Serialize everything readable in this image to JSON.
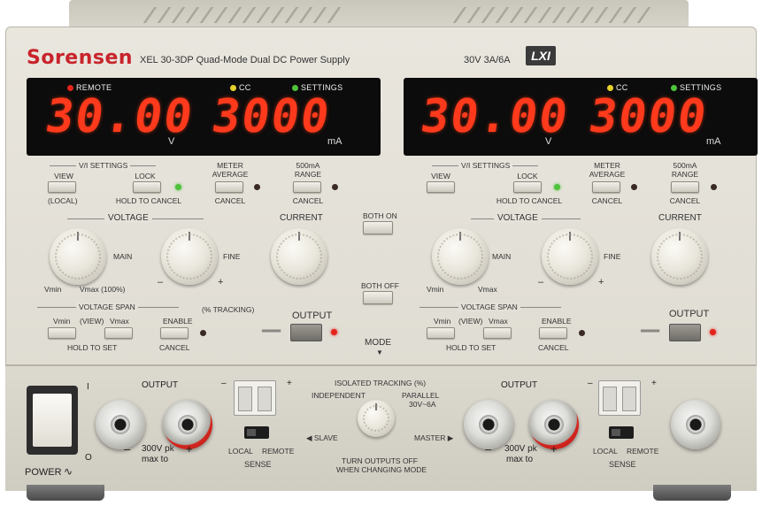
{
  "header": {
    "brand": "Sorensen",
    "model": "XEL 30-3DP Quad-Mode Dual DC Power Supply",
    "rating": "30V  3A/6A",
    "lxi_badge": "LXI"
  },
  "display_left": {
    "voltage": "30.00",
    "voltage_unit": "V",
    "current": "3000",
    "current_unit": "mA",
    "ind_remote": "REMOTE",
    "ind_cc": "CC",
    "ind_settings": "SETTINGS"
  },
  "display_right": {
    "voltage": "30.00",
    "voltage_unit": "V",
    "current": "3000",
    "current_unit": "mA",
    "ind_cc": "CC",
    "ind_settings": "SETTINGS"
  },
  "controls_left": {
    "vi_settings": "V/I SETTINGS",
    "view": "VIEW",
    "local": "(LOCAL)",
    "lock": "LOCK",
    "hold_to_cancel": "HOLD TO CANCEL",
    "meter_average_1": "METER",
    "meter_average_2": "AVERAGE",
    "cancel": "CANCEL",
    "range_1": "500mA",
    "range_2": "RANGE",
    "voltage": "VOLTAGE",
    "current": "CURRENT",
    "main": "MAIN",
    "fine": "FINE",
    "vmin": "Vmin",
    "vmax_100": "Vmax (100%)",
    "minus": "–",
    "plus": "+",
    "voltage_span": "VOLTAGE  SPAN",
    "tracking": "(% TRACKING)",
    "span_vmin": "Vmin",
    "span_view": "(VIEW)",
    "span_vmax": "Vmax",
    "hold_to_set": "HOLD TO SET",
    "enable": "ENABLE",
    "output": "OUTPUT"
  },
  "controls_right": {
    "vi_settings": "V/I SETTINGS",
    "view": "VIEW",
    "lock": "LOCK",
    "hold_to_cancel": "HOLD TO CANCEL",
    "meter_average_1": "METER",
    "meter_average_2": "AVERAGE",
    "cancel": "CANCEL",
    "range_1": "500mA",
    "range_2": "RANGE",
    "voltage": "VOLTAGE",
    "current": "CURRENT",
    "main": "MAIN",
    "fine": "FINE",
    "vmin": "Vmin",
    "vmax": "Vmax",
    "minus": "–",
    "plus": "+",
    "voltage_span": "VOLTAGE  SPAN",
    "span_vmin": "Vmin",
    "span_view": "(VIEW)",
    "span_vmax": "Vmax",
    "hold_to_set": "HOLD TO SET",
    "enable": "ENABLE",
    "output": "OUTPUT"
  },
  "center": {
    "both_on": "BOTH ON",
    "both_off": "BOTH OFF",
    "mode": "MODE"
  },
  "lower": {
    "power": "POWER",
    "power_on": "I",
    "power_off": "O",
    "output_left": "OUTPUT",
    "output_right": "OUTPUT",
    "max_left_1": "300V pk",
    "max_left_2": "max to",
    "max_right_1": "300V pk",
    "max_right_2": "max to",
    "sense_left": "SENSE",
    "sense_right": "SENSE",
    "local_left": "LOCAL",
    "remote_left": "REMOTE",
    "local_right": "LOCAL",
    "remote_right": "REMOTE",
    "isolated_tracking": "ISOLATED TRACKING (%)",
    "independent": "INDEPENDENT",
    "parallel": "PARALLEL",
    "parallel_spec": "30V~6A",
    "slave": "SLAVE",
    "master": "MASTER",
    "turn_off_1": "TURN OUTPUTS OFF",
    "turn_off_2": "WHEN CHANGING MODE",
    "minus": "–",
    "plus": "+"
  }
}
